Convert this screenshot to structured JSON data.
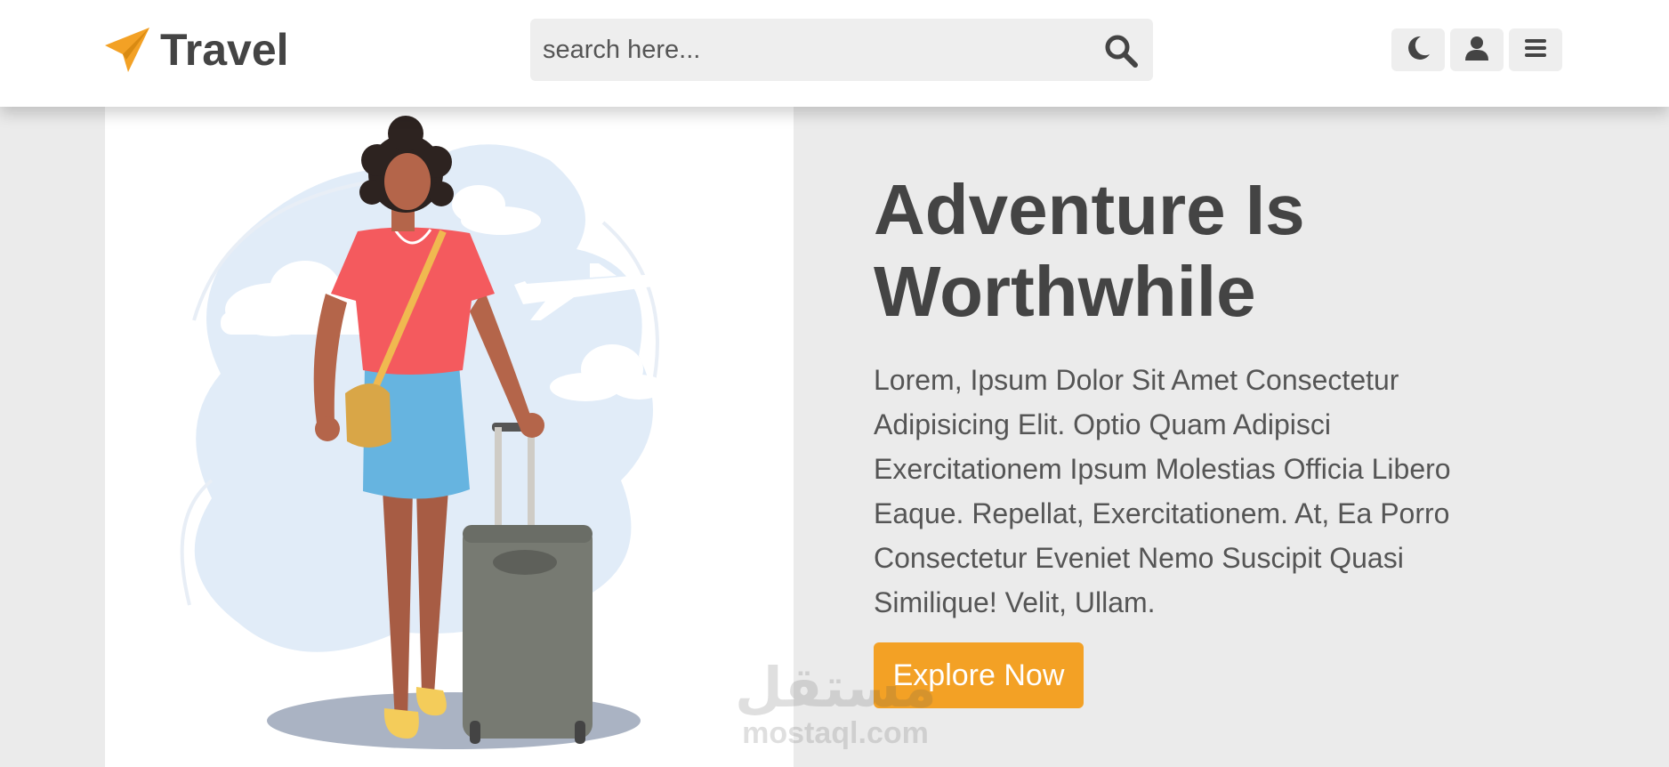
{
  "header": {
    "logo_text": "Travel",
    "logo_icon": "paper-plane-icon",
    "search": {
      "placeholder": "search here...",
      "icon": "search-icon"
    },
    "icons": [
      "moon-icon",
      "user-icon",
      "bars-icon"
    ]
  },
  "hero": {
    "title": "Adventure Is Worthwhile",
    "description": "Lorem, Ipsum Dolor Sit Amet Consectetur Adipisicing Elit. Optio Quam Adipisci Exercitationem Ipsum Molestias Officia Libero Eaque. Repellat, Exercitationem. At, Ea Porro Consectetur Eveniet Nemo Suscipit Quasi Similique! Velit, Ullam.",
    "button_label": "Explore Now",
    "illustration": "woman-with-suitcase-illustration"
  },
  "watermark": {
    "arabic": "مستقل",
    "latin": "mostaql.com"
  },
  "colors": {
    "accent": "#f3a125",
    "text": "#444444",
    "background": "#ebebeb",
    "header_bg": "#ffffff"
  }
}
